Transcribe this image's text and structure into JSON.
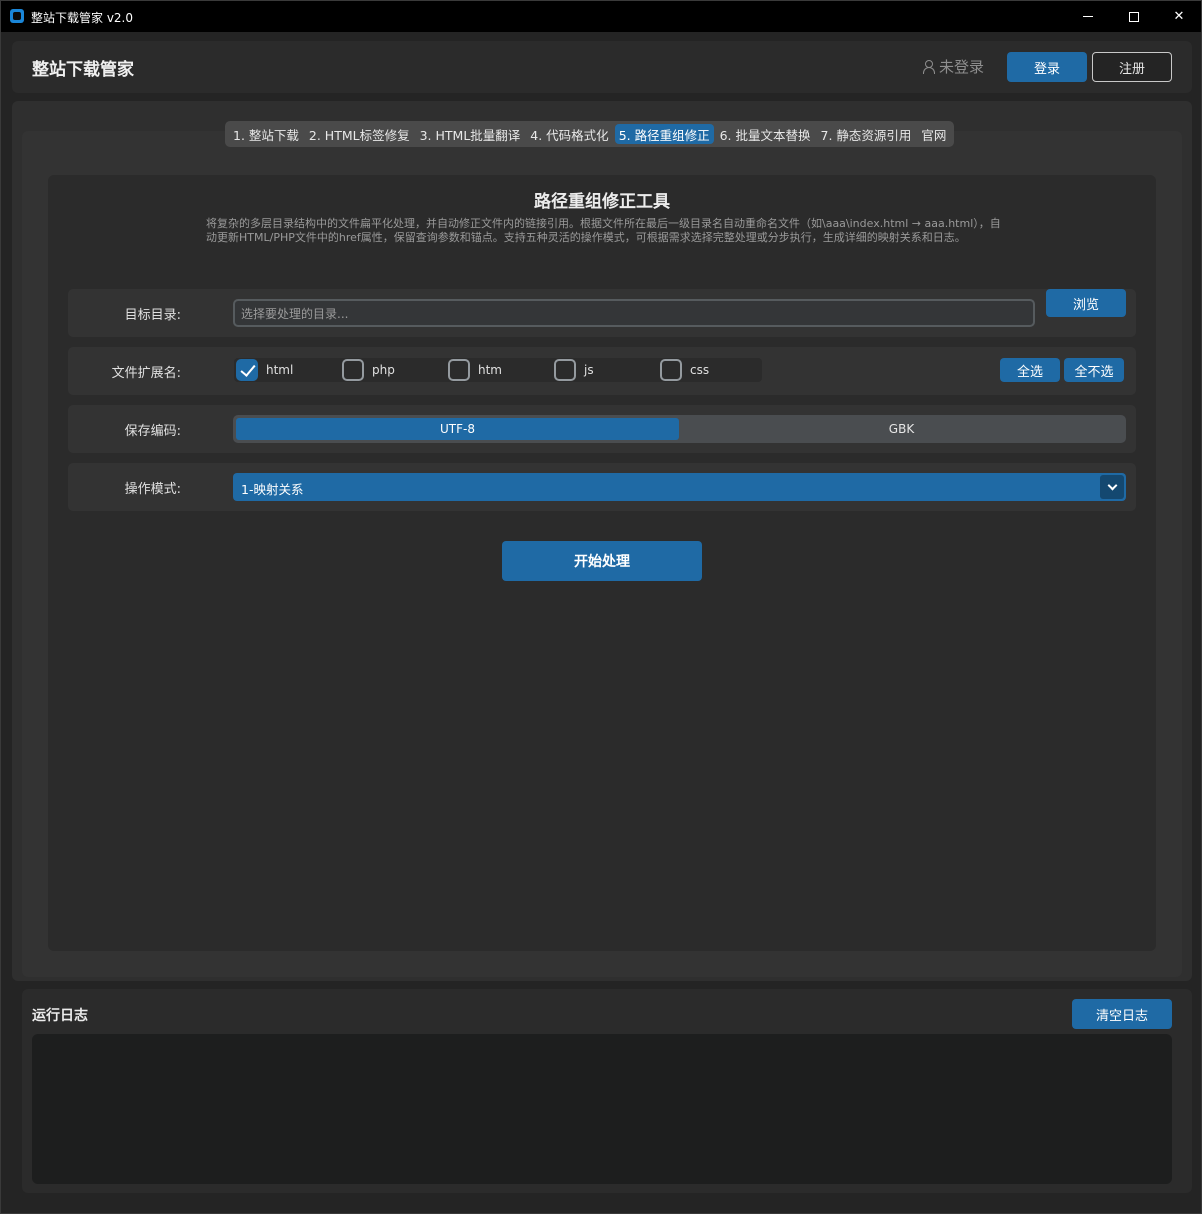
{
  "window": {
    "title": "整站下载管家 v2.0",
    "controls": {
      "minimize": "minimize",
      "maximize": "maximize",
      "close": "✕"
    }
  },
  "header": {
    "brand": "整站下载管家",
    "user_status": "未登录",
    "login_label": "登录",
    "register_label": "注册"
  },
  "tabs": [
    {
      "label": "1. 整站下载",
      "active": false
    },
    {
      "label": "2. HTML标签修复",
      "active": false
    },
    {
      "label": "3. HTML批量翻译",
      "active": false
    },
    {
      "label": "4. 代码格式化",
      "active": false
    },
    {
      "label": "5. 路径重组修正",
      "active": true
    },
    {
      "label": "6. 批量文本替换",
      "active": false
    },
    {
      "label": "7. 静态资源引用",
      "active": false
    },
    {
      "label": "官网",
      "active": false
    }
  ],
  "panel": {
    "title": "路径重组修正工具",
    "description": "将复杂的多层目录结构中的文件扁平化处理，并自动修正文件内的链接引用。根据文件所在最后一级目录名自动重命名文件（如\\aaa\\index.html → aaa.html），自动更新HTML/PHP文件中的href属性，保留查询参数和锚点。支持五种灵活的操作模式，可根据需求选择完整处理或分步执行，生成详细的映射关系和日志。",
    "target_dir": {
      "label": "目标目录:",
      "placeholder": "选择要处理的目录...",
      "value": "",
      "browse_label": "浏览"
    },
    "extensions": {
      "label": "文件扩展名:",
      "items": [
        {
          "name": "html",
          "checked": true
        },
        {
          "name": "php",
          "checked": false
        },
        {
          "name": "htm",
          "checked": false
        },
        {
          "name": "js",
          "checked": false
        },
        {
          "name": "css",
          "checked": false
        }
      ],
      "select_all_label": "全选",
      "select_none_label": "全不选"
    },
    "encoding": {
      "label": "保存编码:",
      "options": [
        "UTF-8",
        "GBK"
      ],
      "selected": "UTF-8"
    },
    "mode": {
      "label": "操作模式:",
      "selected": "1-映射关系"
    },
    "start_label": "开始处理"
  },
  "log": {
    "title": "运行日志",
    "clear_label": "清空日志",
    "content": ""
  },
  "colors": {
    "accent": "#1f6aa5",
    "background": "#242424",
    "panel": "#2b2b2b",
    "titlebar": "#000000"
  }
}
